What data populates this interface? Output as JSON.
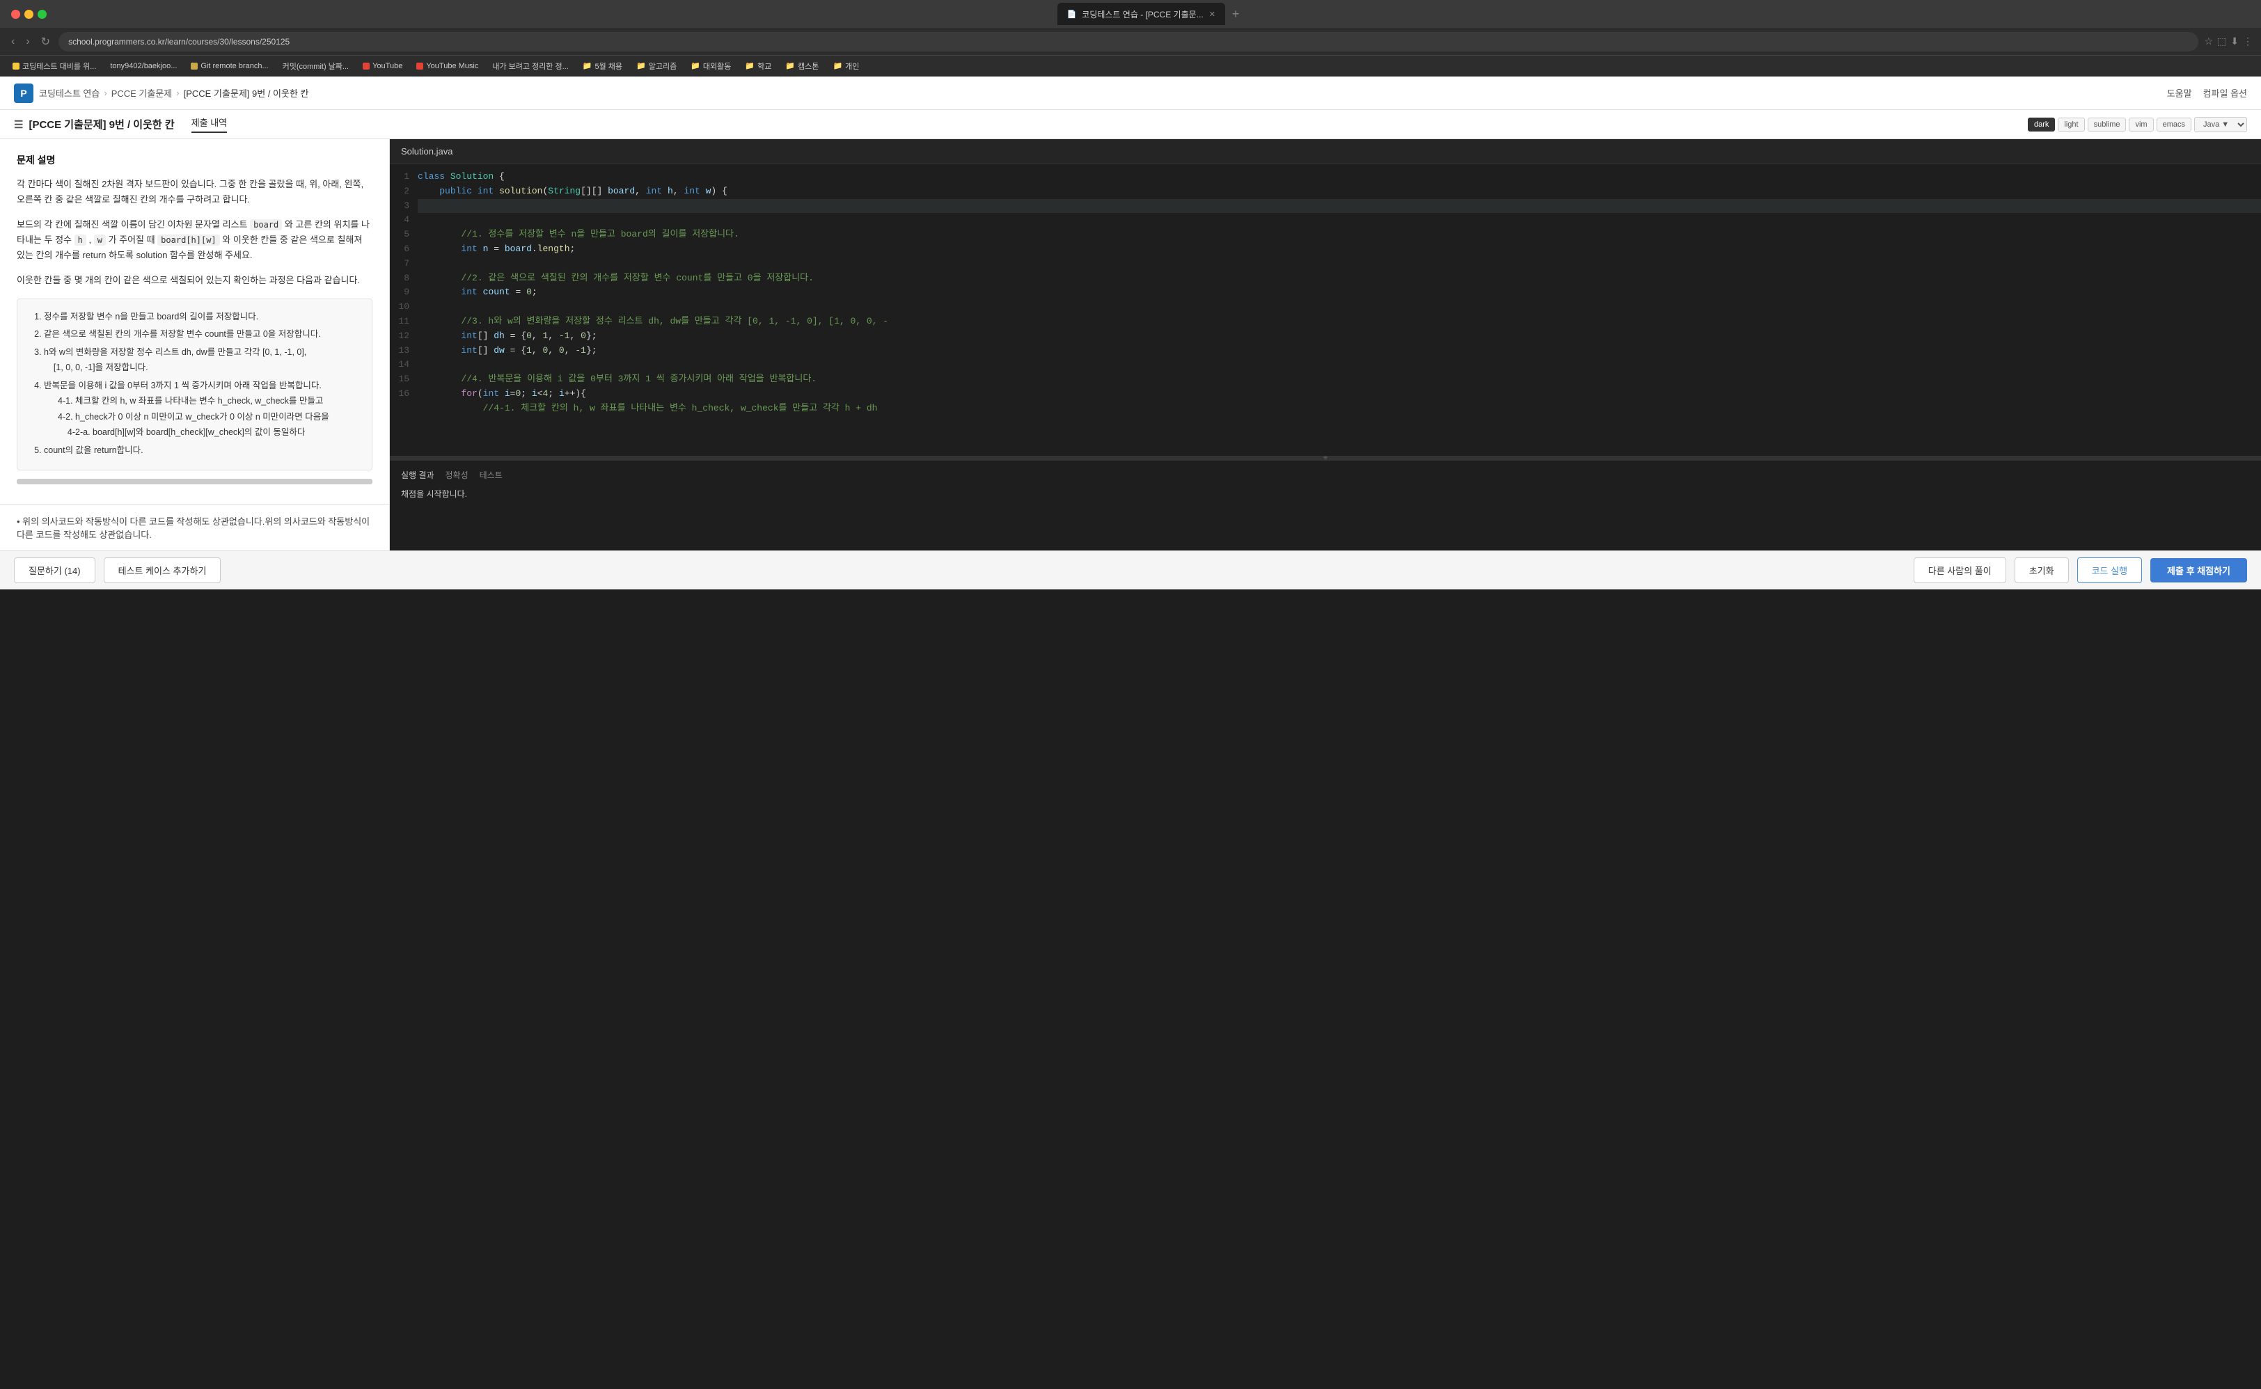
{
  "browser": {
    "traffic_lights": [
      "red",
      "yellow",
      "green"
    ],
    "tab_title": "코딩테스트 연습 - [PCCE 기출문...",
    "tab_close": "✕",
    "tab_new": "+",
    "nav": {
      "back": "‹",
      "forward": "›",
      "reload": "↻",
      "url": "school.programmers.co.kr/learn/courses/30/lessons/250125"
    },
    "bookmarks": [
      {
        "label": "코딩테스트 대비를 위...",
        "icon": "yellow",
        "type": "site"
      },
      {
        "label": "tony9402/baekjoo...",
        "icon": "none",
        "type": "site"
      },
      {
        "label": "Git remote branch...",
        "icon": "bookmark",
        "type": "site"
      },
      {
        "label": "커밋(commit) 날짜...",
        "icon": "none",
        "type": "site"
      },
      {
        "label": "YouTube",
        "icon": "red",
        "type": "site"
      },
      {
        "label": "YouTube Music",
        "icon": "red",
        "type": "site"
      },
      {
        "label": "내가 보려고 정리한 정...",
        "icon": "none",
        "type": "site"
      },
      {
        "label": "5월 채용",
        "icon": "folder",
        "type": "folder"
      },
      {
        "label": "알고리즘",
        "icon": "folder",
        "type": "folder"
      },
      {
        "label": "대외활동",
        "icon": "folder",
        "type": "folder"
      },
      {
        "label": "학교",
        "icon": "folder",
        "type": "folder"
      },
      {
        "label": "캡스톤",
        "icon": "folder",
        "type": "folder"
      },
      {
        "label": "개인",
        "icon": "folder",
        "type": "folder"
      }
    ]
  },
  "app_header": {
    "breadcrumb": [
      "코딩테스트 연습",
      "PCCE 기출문제",
      "[PCCE 기출문제] 9번 / 이웃한 칸"
    ],
    "help": "도움말",
    "compile_options": "컴파일 옵션"
  },
  "problem": {
    "title": "[PCCE 기출문제] 9번 / 이웃한 칸",
    "tab_problem": "제출 내역",
    "section_title": "문제 설명",
    "description_1": "각 칸마다 색이 칠해진 2차원 격자 보드판이 있습니다. 그중 한 칸을 골랐을 때, 위, 아래, 왼쪽, 오른쪽 칸 중 같은 색깔로 칠해진 칸의 개수를 구하려고 합니다.",
    "description_2": "보드의 각 칸에 칠해진 색깔 이름이 담긴 이차원 문자열 리스트  board  와 고른 칸의 위치를 나타내는 두 정수  h ,  w  가 주어질 때  board[h][w]  와 이웃한 칸들 중 같은 색으로 칠해져 있는 칸의 개수를 return 하도록 solution 함수를 완성해 주세요.",
    "description_3": "이웃한 칸들 중 몇 개의 칸이 같은 색으로 색칠되어 있는지 확인하는 과정은 다음과 같습니다.",
    "pseudocode": [
      "1. 정수를 저장할 변수 n을 만들고 board의 길이를 저장합니다.",
      "2. 같은 색으로 색칠된 칸의 개수를 저장할 변수 count를 만들고 0을 저장합니다.",
      "3. h와 w의 변화량을 저장할 정수 리스트 dh, dw를 만들고 각각 [0, 1, -1, 0],",
      "   [1, 0, 0, -1]을 저장합니다.",
      "4. 반복문을 이용해 i 값을 0부터 3까지 1 씩 증가시키며 아래 작업을 반복합니다.",
      "   4-1. 체크할 칸의 h, w 좌표를 나타내는 변수 h_check, w_check를 만들고",
      "   4-2. h_check가 0 이상 n 미만이고 w_check가 0 이상 n 미만이라면 다음을",
      "      4-2-a. board[h][w]와 board[h_check][w_check]의 값이 동일하다",
      "5. count의 값을 return합니다."
    ],
    "note": "위의 의사코드와 작동방식이 다른 코드를 작성해도 상관없습니다."
  },
  "editor": {
    "filename": "Solution.java",
    "themes": [
      "dark",
      "light",
      "sublime",
      "vim",
      "emacs"
    ],
    "active_theme": "dark",
    "language": "Java",
    "code_lines": [
      {
        "num": "1",
        "content": "class Solution {",
        "highlight": false
      },
      {
        "num": "2",
        "content": "    public int solution(String[][] board, int h, int w) {",
        "highlight": false
      },
      {
        "num": "3",
        "content": "",
        "highlight": true
      },
      {
        "num": "4",
        "content": "        //1. 정수를 저장할 변수 n을 만들고 board의 길이를 저장합니다.",
        "highlight": false
      },
      {
        "num": "5",
        "content": "        int n = board.length;",
        "highlight": false
      },
      {
        "num": "6",
        "content": "",
        "highlight": false
      },
      {
        "num": "7",
        "content": "        //2. 같은 색으로 색칠된 칸의 개수를 저장할 변수 count를 만들고 0을 저장합니다.",
        "highlight": false
      },
      {
        "num": "8",
        "content": "        int count = 0;",
        "highlight": false
      },
      {
        "num": "9",
        "content": "",
        "highlight": false
      },
      {
        "num": "10",
        "content": "        //3. h와 w의 변화량을 저장할 정수 리스트 dh, dw를 만들고 각각 [0, 1, -1, 0], [1, 0, 0, -",
        "highlight": false
      },
      {
        "num": "11",
        "content": "        int[] dh = {0, 1, -1, 0};",
        "highlight": false
      },
      {
        "num": "12",
        "content": "        int[] dw = {1, 0, 0, -1};",
        "highlight": false
      },
      {
        "num": "13",
        "content": "",
        "highlight": false
      },
      {
        "num": "14",
        "content": "        //4. 반복문을 이용해 i 값을 0부터 3까지 1 씩 증가시키며 아래 작업을 반복합니다.",
        "highlight": false
      },
      {
        "num": "15",
        "content": "        for(int i=0; i<4; i++){",
        "highlight": false
      },
      {
        "num": "16",
        "content": "            //4-1. 체크할 칸의 h, w 좌표를 나타내는 변수 h_check, w_check를 만들고 각각 h + dh",
        "highlight": false
      }
    ]
  },
  "results": {
    "label": "실행 결과",
    "tabs": [
      "정확성",
      "테스트"
    ],
    "active_tab": "정확성",
    "status_text": "채점을 시작합니다."
  },
  "buttons": {
    "question": "질문하기 (14)",
    "add_test": "테스트 케이스 추가하기",
    "other_solution": "다른 사람의 풀이",
    "reset": "초기화",
    "run_code": "코드 실행",
    "submit": "제출 후 채점하기"
  }
}
